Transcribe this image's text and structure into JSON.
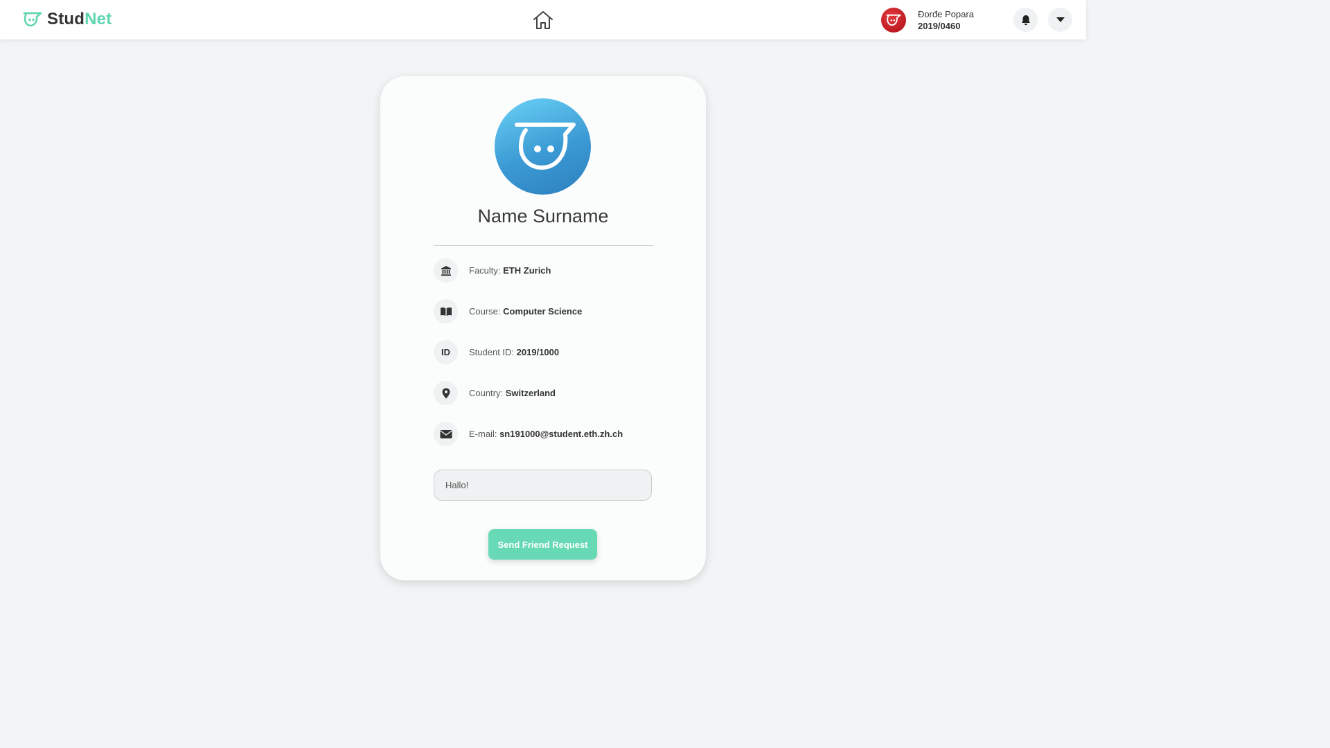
{
  "header": {
    "logo_part1": "Stud",
    "logo_part2": "Net",
    "logo_icon": "studnet-logo-icon",
    "home_icon": "home-icon",
    "user": {
      "name": "Đorđe Popara",
      "id": "2019/0460",
      "avatar_icon": "user-avatar-icon"
    },
    "bell_icon": "bell-icon",
    "menu_icon": "chevron-down-icon"
  },
  "profile": {
    "avatar_icon": "studnet-avatar-icon",
    "name": "Name Surname",
    "rows": [
      {
        "icon": "university-icon",
        "label": "Faculty:",
        "value": "ETH Zurich"
      },
      {
        "icon": "book-icon",
        "label": "Course:",
        "value": "Computer Science"
      },
      {
        "icon": "id-icon",
        "icon_text": "ID",
        "label": "Student ID:",
        "value": "2019/1000"
      },
      {
        "icon": "location-pin-icon",
        "label": "Country:",
        "value": "Switzerland"
      },
      {
        "icon": "envelope-icon",
        "label": "E-mail:",
        "value": "sn191000@student.eth.zh.ch"
      }
    ],
    "message": {
      "value": "Hallo!",
      "placeholder": ""
    },
    "send_button_label": "Send Friend Request"
  },
  "colors": {
    "accent": "#5dd6b0",
    "button": "#67d9b4",
    "background": "#f1f5f5",
    "avatar_blue": "#3b9ad4",
    "user_avatar_red": "#c8191f"
  }
}
